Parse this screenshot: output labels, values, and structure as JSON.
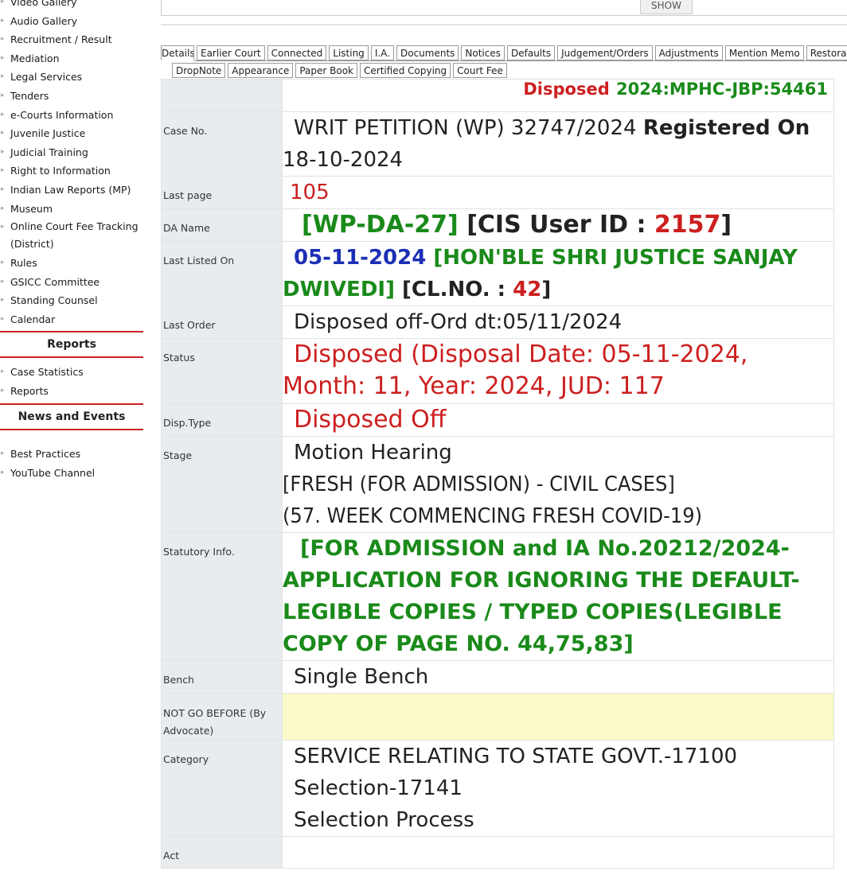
{
  "sidebar": {
    "main_items": [
      "Video Gallery",
      "Audio Gallery",
      "Recruitment / Result",
      "Mediation",
      "Legal Services",
      "Tenders",
      "e-Courts Information",
      "Juvenile Justice",
      "Judicial Training",
      "Right to Information",
      "Indian Law Reports (MP)",
      "Museum",
      "Online Court Fee Tracking (District)",
      "Rules",
      "GSICC Committee",
      "Standing Counsel",
      "Calendar"
    ],
    "reports_heading": "Reports",
    "reports_items": [
      "Case Statistics",
      "Reports"
    ],
    "news_heading": "News and Events",
    "news_items": [
      "Best Practices",
      "YouTube Channel"
    ]
  },
  "topbar": {
    "show_label": "SHOW"
  },
  "tabs": {
    "row1": [
      "Details",
      "Earlier Court",
      "Connected",
      "Listing",
      "I.A.",
      "Documents",
      "Notices",
      "Defaults",
      "Judgement/Orders",
      "Adjustments",
      "Mention Memo",
      "Restoration"
    ],
    "row2": [
      "DropNote",
      "Appearance",
      "Paper Book",
      "Certified Copying",
      "Court Fee"
    ],
    "active": "Details"
  },
  "case": {
    "header_status": "Disposed",
    "header_code": "2024:MPHC-JBP:54461",
    "labels": {
      "case_no": "Case No.",
      "last_page": "Last page",
      "da_name": "DA Name",
      "last_listed": "Last Listed On",
      "last_order": "Last Order",
      "status": "Status",
      "disp_type": "Disp.Type",
      "stage": "Stage",
      "statutory": "Statutory Info.",
      "bench": "Bench",
      "not_go_before": "NOT GO BEFORE (By Advocate)",
      "category": "Category",
      "act": "Act"
    },
    "case_no": "WRIT PETITION (WP) 32747/2024",
    "registered_label": "Registered On",
    "registered_date": "18-10-2024",
    "last_page": "105",
    "da_name": "[WP-DA-27]",
    "cis_prefix": "[CIS User ID :",
    "cis_id": "2157",
    "cis_suffix": "]",
    "last_listed_date": "05-11-2024",
    "last_listed_judge": "[HON'BLE SHRI JUSTICE SANJAY DWIVEDI]",
    "clno_prefix": "[CL.NO. :",
    "clno": "42",
    "clno_suffix": "]",
    "last_order": "Disposed off-Ord dt:05/11/2024",
    "status": "Disposed (Disposal Date: 05-11-2024, Month: 11, Year: 2024, JUD: 117",
    "disp_type": "Disposed Off",
    "stage_line1": "Motion Hearing",
    "stage_line2": "[FRESH (FOR ADMISSION) - CIVIL CASES]",
    "stage_line3": "(57. WEEK COMMENCING FRESH COVID-19)",
    "statutory_info": "[FOR ADMISSION and IA No.20212/2024-APPLICATION FOR IGNORING THE DEFAULT-LEGIBLE COPIES / TYPED COPIES(LEGIBLE COPY OF PAGE NO. 44,75,83]",
    "bench": "Single Bench",
    "not_go_before": "",
    "category_line1": "SERVICE RELATING TO STATE GOVT.-17100",
    "category_line2": "Selection-17141",
    "category_line3": "Selection Process",
    "act": ""
  },
  "colors": {
    "red": "#cc1f1f",
    "green": "#1a8a1a",
    "blue": "#1c2fb4",
    "label_bg": "#e9ecef",
    "highlight_bg": "#fafac9",
    "section_border": "#cc2222"
  }
}
